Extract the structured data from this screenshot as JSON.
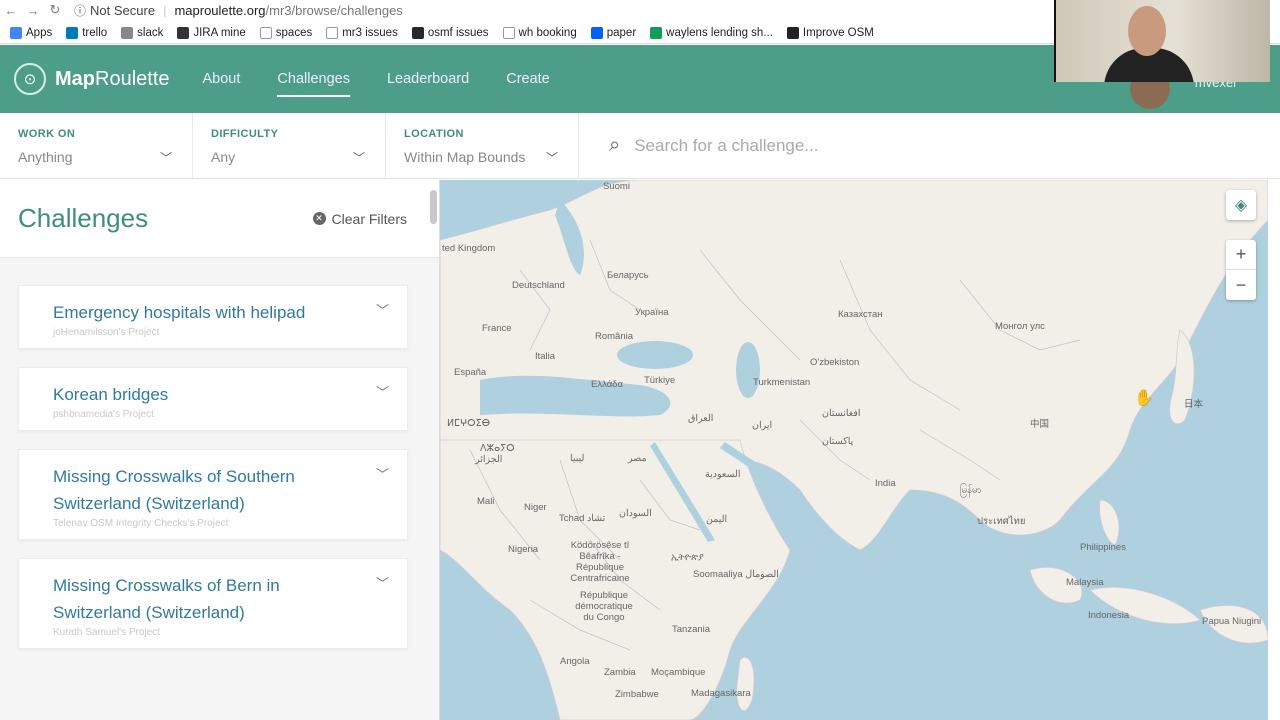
{
  "browser": {
    "security_label": "Not Secure",
    "url_host": "maproulette.org",
    "url_path": "/mr3/browse/challenges",
    "bookmarks": [
      {
        "label": "Apps",
        "color": "#4285f4"
      },
      {
        "label": "trello",
        "color": "#0079bf"
      },
      {
        "label": "slack",
        "color": "#888888"
      },
      {
        "label": "JIRA mine",
        "color": "#333333"
      },
      {
        "label": "spaces",
        "color": "#ffffff"
      },
      {
        "label": "mr3 issues",
        "color": "#ffffff"
      },
      {
        "label": "osmf issues",
        "color": "#24292e"
      },
      {
        "label": "wh booking",
        "color": "#ffffff"
      },
      {
        "label": "paper",
        "color": "#0061fe"
      },
      {
        "label": "waylens lending sh...",
        "color": "#0f9d58"
      },
      {
        "label": "Improve OSM",
        "color": "#222222"
      }
    ]
  },
  "header": {
    "logo_bold": "Map",
    "logo_rest": "Roulette",
    "nav": [
      {
        "label": "About",
        "active": false
      },
      {
        "label": "Challenges",
        "active": true
      },
      {
        "label": "Leaderboard",
        "active": false
      },
      {
        "label": "Create",
        "active": false
      }
    ],
    "user_name": "mvexel",
    "brand_color": "#4c9e88"
  },
  "filters": {
    "work_on": {
      "label": "WORK ON",
      "value": "Anything"
    },
    "difficulty": {
      "label": "DIFFICULTY",
      "value": "Any"
    },
    "location": {
      "label": "LOCATION",
      "value": "Within Map Bounds"
    },
    "search_placeholder": "Search for a challenge..."
  },
  "sidebar": {
    "title": "Challenges",
    "clear_label": "Clear Filters",
    "challenges": [
      {
        "name": "Emergency hospitals with helipad",
        "owner": "joHenamilsson's Project"
      },
      {
        "name": "Korean bridges",
        "owner": "pshbnamedia's Project"
      },
      {
        "name": "Missing Crosswalks of Southern Switzerland (Switzerland)",
        "owner": "Telenav OSM Integrity Checks's Project"
      },
      {
        "name": "Missing Crosswalks of Bern in Switzerland (Switzerland)",
        "owner": "Kurath Samuel's Project"
      }
    ]
  },
  "map": {
    "labels": [
      {
        "text": "Suomi"
      },
      {
        "text": "ted Kingdom"
      },
      {
        "text": "Беларусь"
      },
      {
        "text": "Deutschland"
      },
      {
        "text": "Україна"
      },
      {
        "text": "Казахстан"
      },
      {
        "text": "France"
      },
      {
        "text": "România"
      },
      {
        "text": "Монгол улс"
      },
      {
        "text": "Italia"
      },
      {
        "text": "O'zbekiston"
      },
      {
        "text": "España"
      },
      {
        "text": "Türkiye"
      },
      {
        "text": "Turkmenistan"
      },
      {
        "text": "Ελλάδα"
      },
      {
        "text": "افغانستان"
      },
      {
        "text": "ⵍⵎⵖⵔⵉⴱ"
      },
      {
        "text": "العراق"
      },
      {
        "text": "ایران"
      },
      {
        "text": "中国"
      },
      {
        "text": "پاکستان"
      },
      {
        "text": "日本"
      },
      {
        "text": "ⴷⵣⴰⵢⵔ"
      },
      {
        "text": "الجزائر"
      },
      {
        "text": "ليبيا"
      },
      {
        "text": "مصر"
      },
      {
        "text": "السعودية"
      },
      {
        "text": "India"
      },
      {
        "text": "မြန်မာ"
      },
      {
        "text": "Mali"
      },
      {
        "text": "Niger"
      },
      {
        "text": "Tchad تشاد"
      },
      {
        "text": "السودان"
      },
      {
        "text": "اليمن"
      },
      {
        "text": "ประเทศไทย"
      },
      {
        "text": "Philippines"
      },
      {
        "text": "Nigeria"
      },
      {
        "text": "ኢትዮጵያ"
      },
      {
        "text": "Ködörösêse tî Bêafrîka - République Centrafricaine"
      },
      {
        "text": "Malaysia"
      },
      {
        "text": "Soomaaliya الصومال"
      },
      {
        "text": "République démocratique du Congo"
      },
      {
        "text": "Indonesia"
      },
      {
        "text": "Tanzania"
      },
      {
        "text": "Papua Niugini"
      },
      {
        "text": "Angola"
      },
      {
        "text": "Zambia"
      },
      {
        "text": "Moçambique"
      },
      {
        "text": "Zimbabwe"
      },
      {
        "text": "Madagasikara"
      }
    ],
    "zoom_in_label": "+",
    "zoom_out_label": "−"
  }
}
